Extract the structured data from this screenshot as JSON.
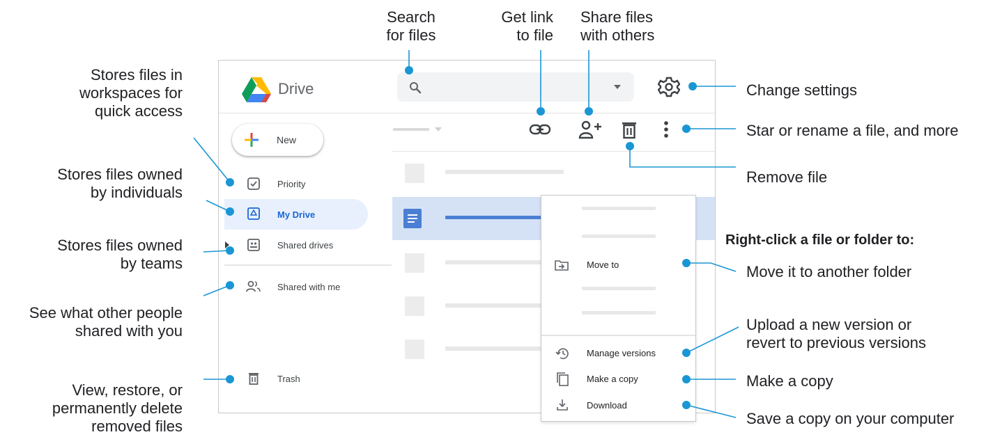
{
  "app": {
    "name": "Drive"
  },
  "search": {
    "placeholder": ""
  },
  "sidebar": {
    "new_label": "New",
    "items": [
      {
        "label": "Priority"
      },
      {
        "label": "My Drive"
      },
      {
        "label": "Shared drives"
      },
      {
        "label": "Shared with me"
      },
      {
        "label": "Trash"
      }
    ]
  },
  "context_menu": {
    "items": [
      {
        "label": "Move to"
      },
      {
        "label": "Manage versions"
      },
      {
        "label": "Make a copy"
      },
      {
        "label": "Download"
      }
    ]
  },
  "callouts": {
    "search": "Search\nfor files",
    "get_link": "Get link\nto file",
    "share": "Share files\nwith others",
    "settings": "Change settings",
    "more": "Star or rename a file, and more",
    "remove": "Remove file",
    "right_click_heading": "Right-click a file or folder to:",
    "move": "Move it to another folder",
    "versions": "Upload a new version or\nrevert to previous versions",
    "copy": "Make a copy",
    "download": "Save a copy on your computer",
    "workspaces": "Stores files in\nworkspaces for\nquick access",
    "individuals": "Stores files owned\nby individuals",
    "teams": "Stores files owned\nby teams",
    "shared": "See what other people\nshared with you",
    "trash": "View, restore, or\npermanently delete\nremoved files"
  },
  "colors": {
    "accent": "#1a96d4",
    "selected_bg": "#e8f0fe",
    "selected_row": "#d5e2f6",
    "doc_blue": "#4a7fd4"
  }
}
